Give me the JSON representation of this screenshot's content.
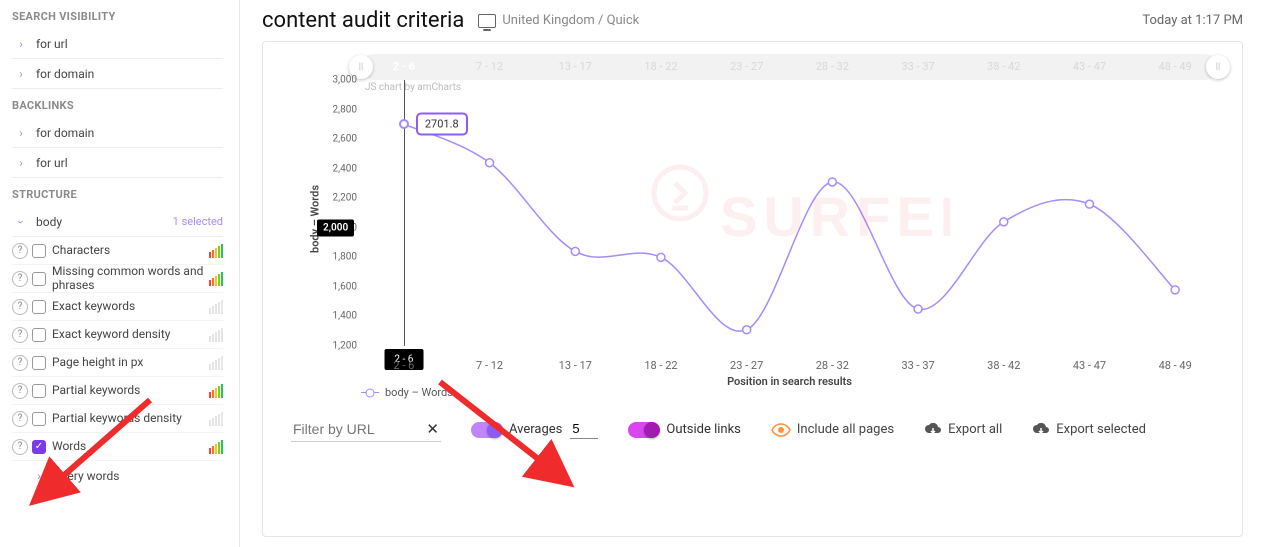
{
  "sidebar": {
    "sections": [
      {
        "title": "SEARCH VISIBILITY",
        "items": [
          {
            "label": "for url"
          },
          {
            "label": "for domain"
          }
        ]
      },
      {
        "title": "BACKLINKS",
        "items": [
          {
            "label": "for domain"
          },
          {
            "label": "for url"
          }
        ]
      },
      {
        "title": "STRUCTURE",
        "items": [
          {
            "label": "body",
            "badge": "1 selected",
            "expanded": true,
            "subs": [
              {
                "label": "Characters",
                "checked": false,
                "bars": "c1"
              },
              {
                "label": "Missing common words and phrases",
                "checked": false,
                "bars": "c1"
              },
              {
                "label": "Exact keywords",
                "checked": false,
                "bars": "dim"
              },
              {
                "label": "Exact keyword density",
                "checked": false,
                "bars": "dim"
              },
              {
                "label": "Page height in px",
                "checked": false,
                "bars": "dim"
              },
              {
                "label": "Partial keywords",
                "checked": false,
                "bars": "c1"
              },
              {
                "label": "Partial keywords density",
                "checked": false,
                "bars": "dim"
              },
              {
                "label": "Words",
                "checked": true,
                "bars": "c1"
              }
            ],
            "child_item": {
              "label": "query words"
            }
          }
        ]
      }
    ]
  },
  "header": {
    "title": "content audit criteria",
    "subtitle": "United Kingdom / Quick",
    "timestamp": "Today at 1:17 PM"
  },
  "chart_data": {
    "type": "line",
    "title": "",
    "xlabel": "Position in search results",
    "ylabel": "body – Words",
    "ylim": [
      1200,
      3000
    ],
    "y_ticks": [
      1200,
      1400,
      1600,
      1800,
      2000,
      2200,
      2400,
      2600,
      2800,
      3000
    ],
    "categories": [
      "2 - 6",
      "7 - 12",
      "13 - 17",
      "18 - 22",
      "23 - 27",
      "28 - 32",
      "33 - 37",
      "38 - 42",
      "43 - 47",
      "48 - 49"
    ],
    "series": [
      {
        "name": "body – Words",
        "values": [
          2701.8,
          2440,
          1840,
          1800,
          1310,
          2310,
          1450,
          2040,
          2160,
          1580
        ]
      }
    ],
    "cursor": {
      "category_index": 0,
      "y_label": "2,000",
      "point_label": "2701.8"
    },
    "credit": "JS chart by amCharts"
  },
  "controls": {
    "filter_placeholder": "Filter by URL",
    "averages_label": "Averages",
    "averages_value": "5",
    "outside_links_label": "Outside links",
    "include_all_label": "Include all pages",
    "export_all_label": "Export all",
    "export_selected_label": "Export selected"
  }
}
